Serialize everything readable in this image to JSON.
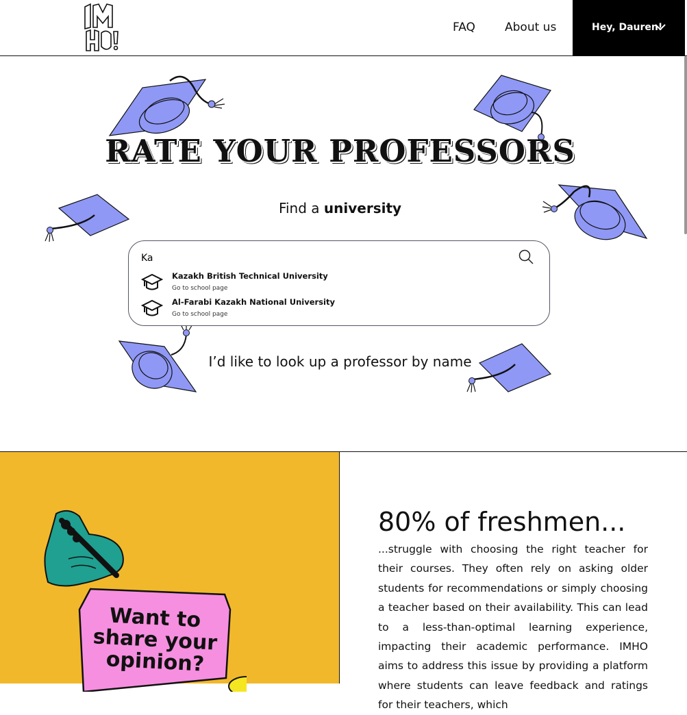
{
  "header": {
    "logo_text": "IMHO!",
    "nav": {
      "faq": "FAQ",
      "about": "About us"
    },
    "user_greeting": "Hey, Dauren!"
  },
  "hero": {
    "title": "RATE YOUR PROFESSORS",
    "find_prefix": "Find a ",
    "find_emphasis": "university",
    "search": {
      "value": "Ka",
      "suggestions": [
        {
          "name": "Kazakh British Technical University",
          "action": "Go to school page"
        },
        {
          "name": "Al-Farabi Kazakh National University",
          "action": "Go to school page"
        }
      ]
    },
    "professor_link": "I’d like to look up a professor by name"
  },
  "promo": {
    "card_text": "Want to share your opinion?"
  },
  "stats": {
    "title": "80% of freshmen...",
    "body": "...struggle with choosing the right teacher for their courses. They often rely on asking older students for recommendations or simply choosing a teacher based on their availability. This can lead to a less-than-optimal learning experience, impacting their academic performance. IMHO aims to address this issue by providing a platform where students can leave feedback and ratings for their teachers, which"
  },
  "colors": {
    "cap_fill": "#8f98f5",
    "promo_bg": "#f2b82c",
    "card_pink": "#f68fe0",
    "teal": "#1fa090",
    "black": "#000000"
  }
}
